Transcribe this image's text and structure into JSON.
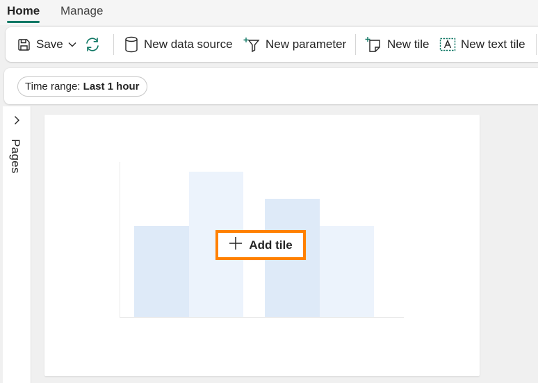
{
  "tabs": [
    {
      "label": "Home",
      "active": true
    },
    {
      "label": "Manage",
      "active": false
    }
  ],
  "toolbar": {
    "save_label": "Save",
    "new_data_source_label": "New data source",
    "new_parameter_label": "New parameter",
    "new_tile_label": "New tile",
    "new_text_tile_label": "New text tile"
  },
  "filter": {
    "time_range_key": "Time range:",
    "time_range_value": "Last 1 hour"
  },
  "side_panel": {
    "label": "Pages"
  },
  "empty_canvas": {
    "add_tile_label": "Add tile"
  },
  "colors": {
    "accent": "#117865",
    "highlight": "#ff8000",
    "bar_dark": "#deeaf8",
    "bar_light": "#ecf3fc"
  },
  "icons": [
    "save-icon",
    "chevron-down-icon",
    "refresh-icon",
    "database-icon",
    "funnel-plus-icon",
    "tile-plus-icon",
    "text-tile-icon",
    "chevron-right-icon",
    "plus-icon"
  ]
}
